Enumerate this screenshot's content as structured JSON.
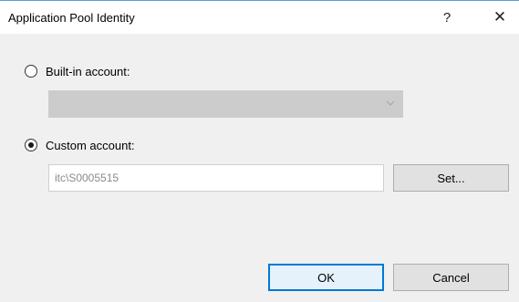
{
  "window": {
    "title": "Application Pool Identity",
    "help_label": "?",
    "close_label": "✕"
  },
  "identity": {
    "builtin": {
      "label": "Built-in account:",
      "selected": false,
      "value": "",
      "enabled": false
    },
    "custom": {
      "label": "Custom account:",
      "selected": true,
      "value": "itc\\S0005515"
    }
  },
  "buttons": {
    "set_label": "Set...",
    "ok_label": "OK",
    "cancel_label": "Cancel"
  },
  "colors": {
    "accent": "#0078d7",
    "dialog_bg": "#f0f0f0",
    "disabled_combo": "#cccccc"
  }
}
